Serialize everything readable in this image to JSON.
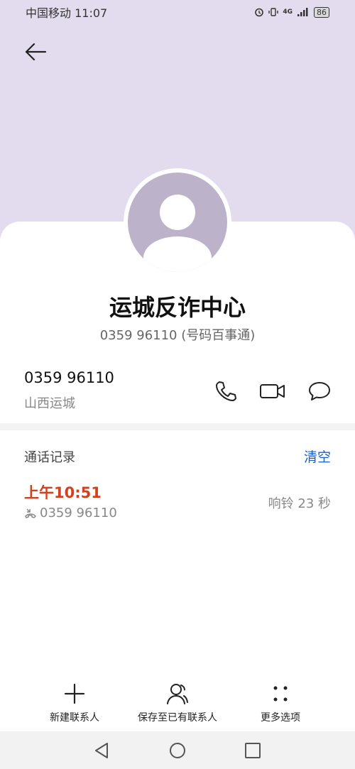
{
  "status_bar": {
    "carrier_time": "中国移动 11:07",
    "network": "4G",
    "battery": "86"
  },
  "contact": {
    "name": "运城反诈中心",
    "subtitle": "0359 96110 (号码百事通)"
  },
  "number": {
    "value": "0359 96110",
    "location": "山西运城"
  },
  "call_records": {
    "title": "通话记录",
    "clear_label": "清空",
    "entries": [
      {
        "time": "上午10:51",
        "number": "0359 96110",
        "duration": "响铃 23 秒"
      }
    ]
  },
  "bottom_actions": [
    {
      "label": "新建联系人",
      "icon": "plus-icon"
    },
    {
      "label": "保存至已有联系人",
      "icon": "person-icon"
    },
    {
      "label": "更多选项",
      "icon": "more-icon"
    }
  ],
  "colors": {
    "header_bg": "#e3dcee",
    "avatar": "#bcb3cb",
    "accent_blue": "#1a5fc5",
    "missed_red": "#d0411f"
  }
}
